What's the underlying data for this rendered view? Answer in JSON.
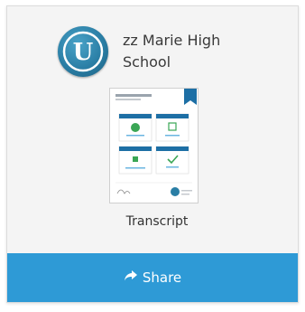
{
  "card": {
    "school_name": "zz Marie High School",
    "logo_letter": "U",
    "document_title": "Transcript",
    "share_label": "Share",
    "colors": {
      "accent": "#2e9ad6",
      "logo": "#2a7ea5",
      "thumb_panel": "#1d6fa5"
    },
    "icons": {
      "share": "share-arrow-icon",
      "logo": "shield-u-icon"
    }
  }
}
